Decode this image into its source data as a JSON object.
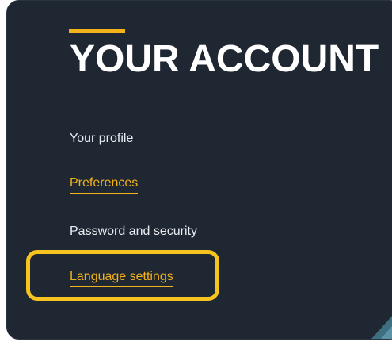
{
  "account_panel": {
    "title": "YOUR ACCOUNT",
    "menu": [
      {
        "label": "Your profile",
        "style": "plain"
      },
      {
        "label": "Preferences",
        "style": "link"
      },
      {
        "label": "Password and security",
        "style": "plain"
      },
      {
        "label": "Language settings",
        "style": "link",
        "highlighted": true
      }
    ]
  },
  "colors": {
    "panel_background": "#1f2733",
    "accent": "#f2b21a",
    "highlight_outline": "#f7c31f",
    "text": "#e9edf2",
    "title": "#ffffff"
  }
}
